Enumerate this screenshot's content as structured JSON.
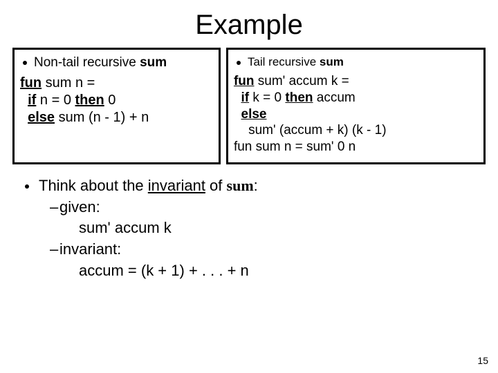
{
  "title": "Example",
  "left": {
    "header_prefix": "Non-tail recursive ",
    "header_bold": "sum",
    "code": {
      "l1a": "fun",
      "l1b": " sum n =",
      "l2a": "  ",
      "l2b": "if",
      "l2c": " n = 0 ",
      "l2d": "then",
      "l2e": " 0",
      "l3a": "  ",
      "l3b": "else",
      "l3c": " sum (n - 1) + n"
    }
  },
  "right": {
    "header_prefix": "Tail recursive ",
    "header_bold": "sum",
    "code": {
      "l1a": "fun",
      "l1b": " sum' accum k =",
      "l2a": "  ",
      "l2b": "if",
      "l2c": " k = 0 ",
      "l2d": "then",
      "l2e": " accum",
      "l3a": "  ",
      "l3b": "else",
      "l4": "    sum' (accum + k) (k - 1)",
      "l5": "fun sum n = sum' 0 n"
    }
  },
  "lower": {
    "line1a": "Think about the ",
    "line1b": "invariant",
    "line1c": " of ",
    "line1d": "sum",
    "line1e": ":",
    "given": "given:",
    "given_code": "sum' accum k",
    "inv": "invariant:",
    "inv_code": "accum = (k + 1) + . . . + n"
  },
  "page_number": "15"
}
